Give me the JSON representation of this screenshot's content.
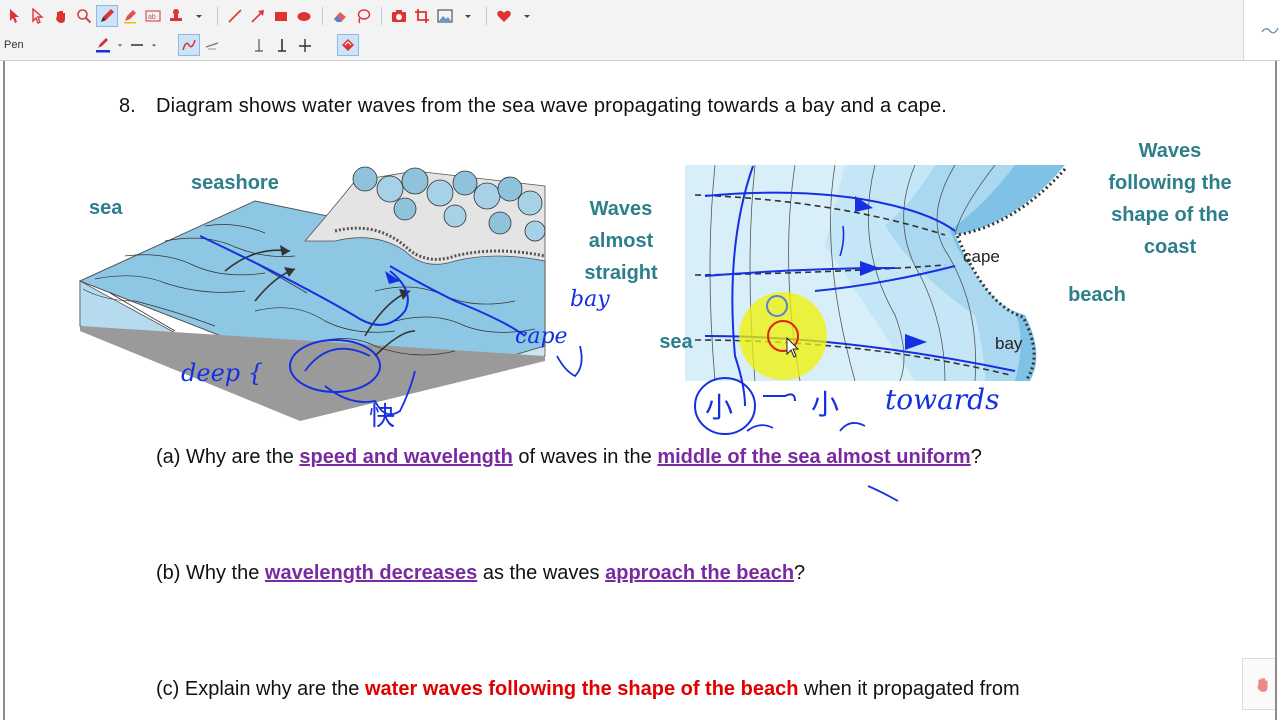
{
  "toolbar": {
    "tool_label": "Pen"
  },
  "question": {
    "number": "8.",
    "text": "Diagram shows water waves from the sea wave propagating towards a bay and a cape."
  },
  "left_diagram": {
    "label_sea": "sea",
    "label_seashore": "seashore",
    "annot_bay": "bay",
    "annot_cape": "cape",
    "annot_deep": "deep {",
    "annot_fast": "快"
  },
  "right_diagram": {
    "label_waves_straight_1": "Waves",
    "label_waves_straight_2": "almost",
    "label_waves_straight_3": "straight",
    "label_following_1": "Waves",
    "label_following_2": "following the",
    "label_following_3": "shape of the",
    "label_following_4": "coast",
    "label_cape": "cape",
    "label_bay": "bay",
    "label_beach": "beach",
    "label_sea": "sea",
    "annot_towards": "towards",
    "annot_chinese_1": "小",
    "annot_chinese_2": "小"
  },
  "parts": {
    "a_prefix": "(a) Why are the ",
    "a_u1": "speed and wavelength",
    "a_mid": " of waves in the ",
    "a_u2": "middle of the sea almost uniform",
    "a_end": "?",
    "b_prefix": "(b) Why the ",
    "b_u1": "wavelength decreases",
    "b_mid": " as the waves ",
    "b_u2": "approach the beach",
    "b_end": "?",
    "c_prefix": "(c) Explain why are the ",
    "c_red": "water waves following the shape of the beach",
    "c_end": " when it propagated from"
  },
  "colors": {
    "ink_blue": "#1530e0",
    "label_teal": "#2e7f8c",
    "underline_purple": "#7a2aa0",
    "emphasis_red": "#e00000",
    "highlight_yellow": "#f2f200"
  }
}
